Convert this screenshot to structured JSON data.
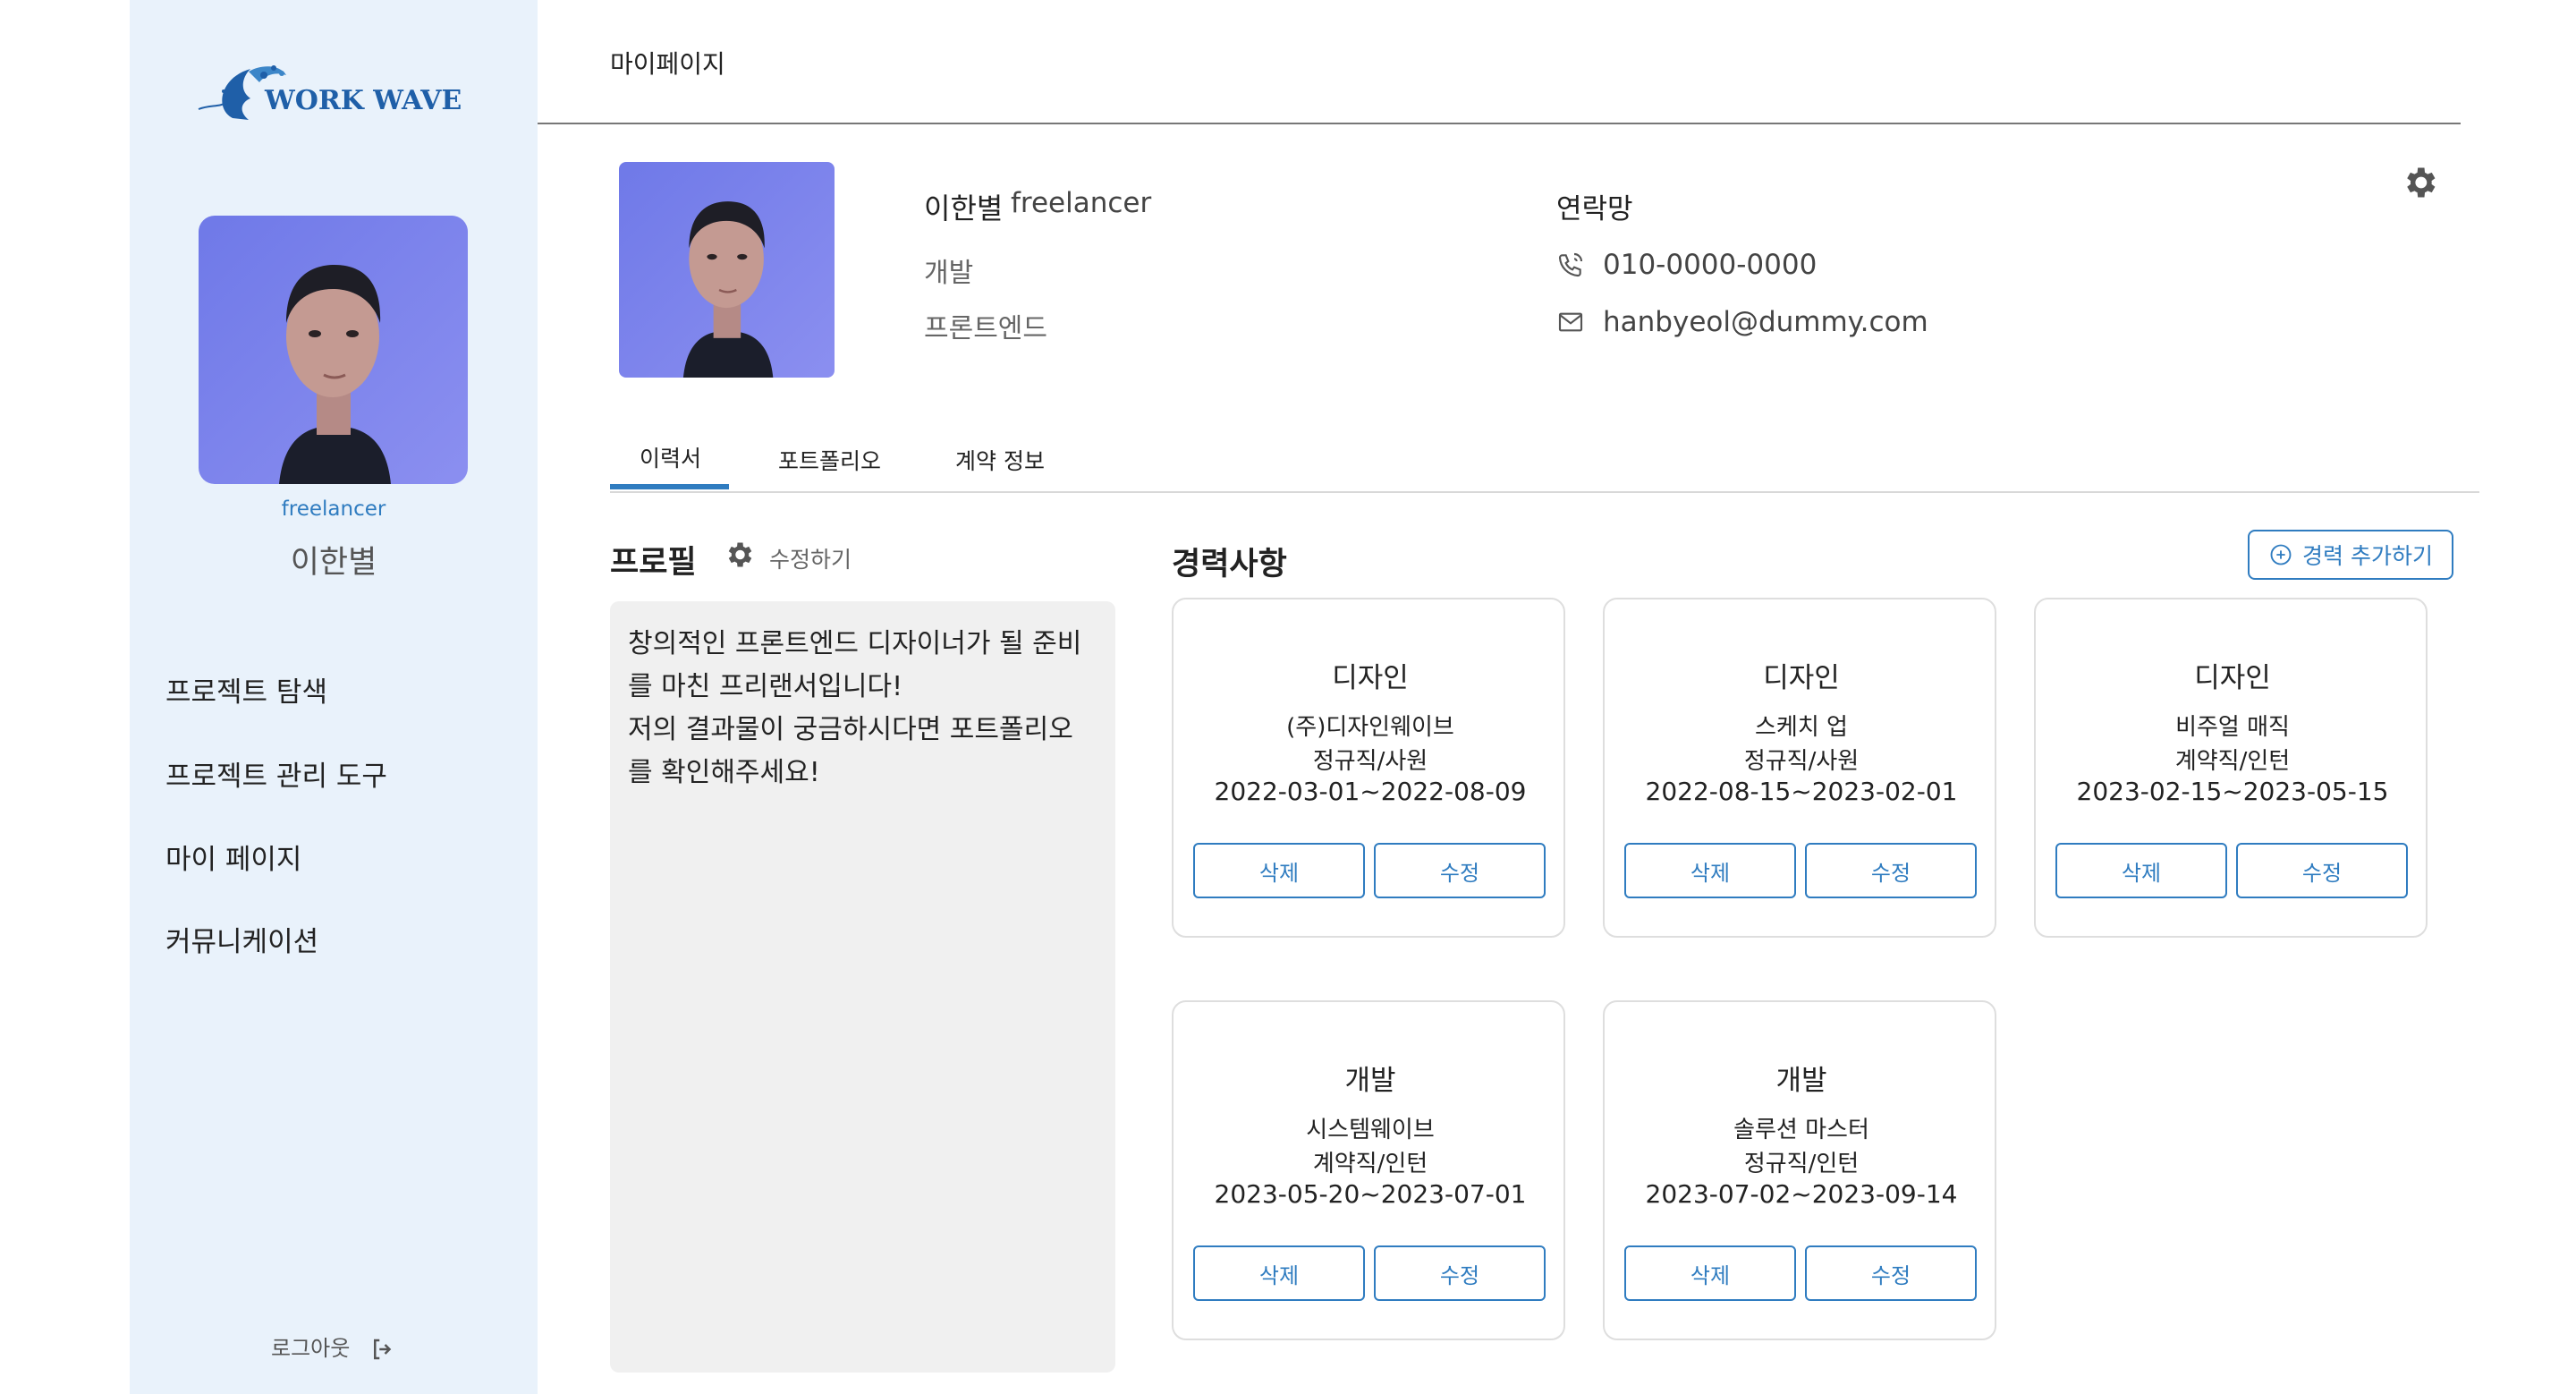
{
  "sidebar": {
    "logo_text": "WORK WAVE",
    "role": "freelancer",
    "name": "이한별",
    "nav": [
      {
        "label": "프로젝트 탐색",
        "icon": null
      },
      {
        "label": "프로젝트 관리 도구",
        "icon": null
      },
      {
        "label": "마이 페이지",
        "icon": null
      },
      {
        "label": "커뮤니케이션",
        "icon": null
      }
    ],
    "logout_label": "로그아웃",
    "logout_icon": "logout-icon"
  },
  "header": {
    "title": "마이페이지"
  },
  "profile_header": {
    "name": "이한별",
    "role": "freelancer",
    "field": "개발",
    "subfield": "프론트엔드",
    "contact_title": "연락망",
    "phone": "010-0000-0000",
    "email": "hanbyeol@dummy.com",
    "phone_icon": "phone-icon",
    "email_icon": "mail-icon",
    "settings_icon": "gear-icon"
  },
  "tabs": [
    {
      "label": "이력서",
      "active": true
    },
    {
      "label": "포트폴리오",
      "active": false
    },
    {
      "label": "계약 정보",
      "active": false
    }
  ],
  "profile_section": {
    "title": "프로필",
    "edit_label": "수정하기",
    "intro_lines": [
      "창의적인 프론트엔드 디자이너가 될 준비",
      "를 마친 프리랜서입니다!",
      "저의 결과물이 궁금하시다면 포트폴리오",
      "를 확인해주세요!"
    ]
  },
  "career": {
    "title": "경력사항",
    "add_label": "경력 추가하기",
    "delete_label": "삭제",
    "edit_label": "수정",
    "items": [
      {
        "category": "디자인",
        "company": "(주)디자인웨이브",
        "type": "정규직/사원",
        "dates": "2022-03-01~2022-08-09"
      },
      {
        "category": "디자인",
        "company": "스케치 업",
        "type": "정규직/사원",
        "dates": "2022-08-15~2023-02-01"
      },
      {
        "category": "디자인",
        "company": "비주얼 매직",
        "type": "계약직/인턴",
        "dates": "2023-02-15~2023-05-15"
      },
      {
        "category": "개발",
        "company": "시스템웨이브",
        "type": "계약직/인턴",
        "dates": "2023-05-20~2023-07-01"
      },
      {
        "category": "개발",
        "company": "솔루션 마스터",
        "type": "정규직/인턴",
        "dates": "2023-07-02~2023-09-14"
      }
    ]
  },
  "colors": {
    "accent": "#2f7cc0",
    "sidebar_bg": "#e9f2fb",
    "card_border": "#dedede",
    "intro_bg": "#f0f0f0"
  }
}
